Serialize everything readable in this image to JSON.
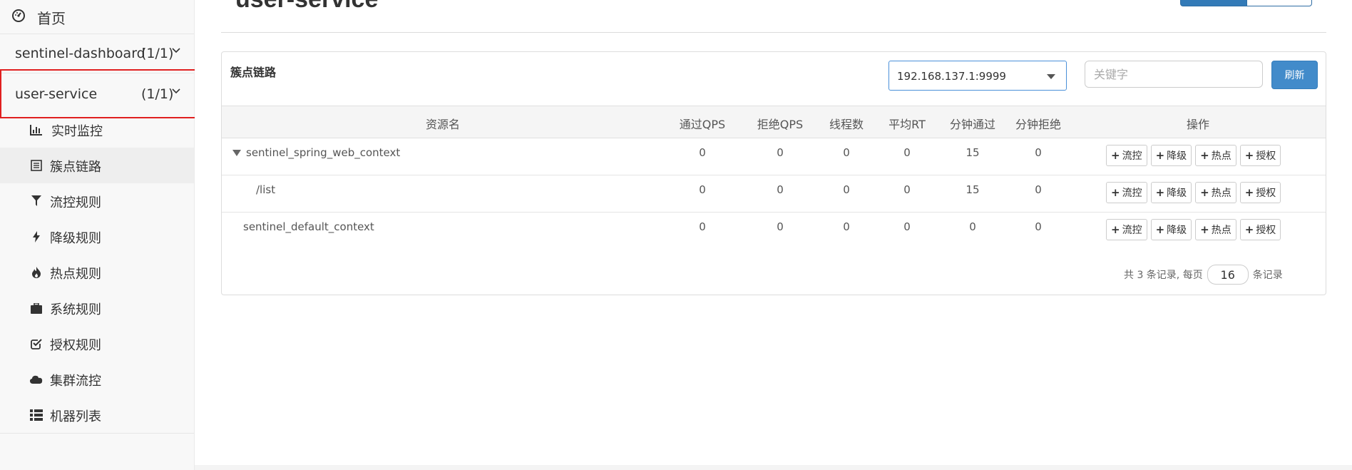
{
  "sidebar": {
    "home_label": "首页",
    "apps": [
      {
        "name": "sentinel-dashboard",
        "count": "(1/1)"
      },
      {
        "name": "user-service",
        "count": "(1/1)"
      }
    ],
    "menu": [
      {
        "label": "实时监控",
        "icon": "bar-chart-icon"
      },
      {
        "label": "簇点链路",
        "icon": "list-icon"
      },
      {
        "label": "流控规则",
        "icon": "filter-icon"
      },
      {
        "label": "降级规则",
        "icon": "flash-icon"
      },
      {
        "label": "热点规则",
        "icon": "fire-icon"
      },
      {
        "label": "系统规则",
        "icon": "briefcase-icon"
      },
      {
        "label": "授权规则",
        "icon": "check-square-icon"
      },
      {
        "label": "集群流控",
        "icon": "cloud-icon"
      },
      {
        "label": "机器列表",
        "icon": "th-list-icon"
      }
    ]
  },
  "main": {
    "page_title": "user-service",
    "panel_title": "簇点链路",
    "machine_selected": "192.168.137.1:9999",
    "keyword_placeholder": "关键字",
    "refresh_label": "刷新"
  },
  "table": {
    "headers": [
      "资源名",
      "通过QPS",
      "拒绝QPS",
      "线程数",
      "平均RT",
      "分钟通过",
      "分钟拒绝",
      "操作"
    ],
    "rows": [
      {
        "name": "sentinel_spring_web_context",
        "pass_qps": "0",
        "block_qps": "0",
        "threads": "0",
        "avg_rt": "0",
        "min_pass": "15",
        "min_block": "0"
      },
      {
        "name": "/list",
        "pass_qps": "0",
        "block_qps": "0",
        "threads": "0",
        "avg_rt": "0",
        "min_pass": "15",
        "min_block": "0"
      },
      {
        "name": "sentinel_default_context",
        "pass_qps": "0",
        "block_qps": "0",
        "threads": "0",
        "avg_rt": "0",
        "min_pass": "0",
        "min_block": "0"
      }
    ],
    "actions": [
      "流控",
      "降级",
      "热点",
      "授权"
    ]
  },
  "pager": {
    "summary": "共 3 条记录, 每页",
    "page_size": "16",
    "suffix": "条记录"
  },
  "colors": {
    "primary": "#428bca",
    "selected_outline": "#e02020",
    "select_border": "#4a90d9"
  }
}
